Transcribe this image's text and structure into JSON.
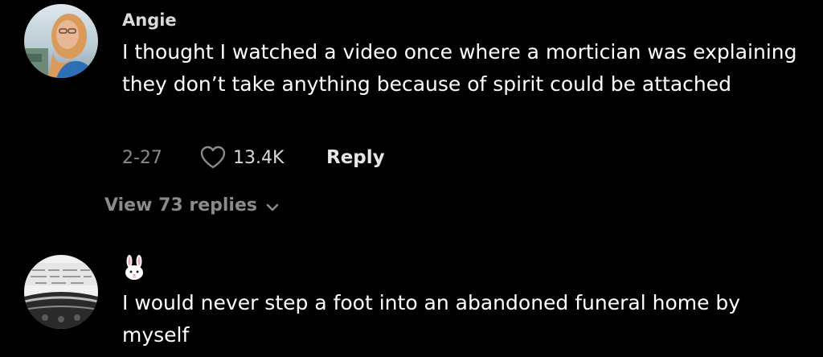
{
  "comments": [
    {
      "username": "Angie",
      "text": "I thought I watched a video once where a mortician was explaining they don’t take anything because of spirit could be attached",
      "date": "2-27",
      "likes": "13.4K",
      "reply_label": "Reply",
      "view_replies_label": "View 73 replies",
      "avatar_icon": "person-photo-avatar"
    },
    {
      "username": "🐰",
      "text": "I would never step a foot into an abandoned funeral home by myself",
      "avatar_icon": "typewriter-photo-avatar"
    }
  ],
  "icons": {
    "like": "heart-icon",
    "expand": "chevron-down-icon"
  },
  "colors": {
    "background": "#000000",
    "primary_text": "#ffffff",
    "secondary_text": "#8a8a8a",
    "username": "#d9d9d9"
  }
}
